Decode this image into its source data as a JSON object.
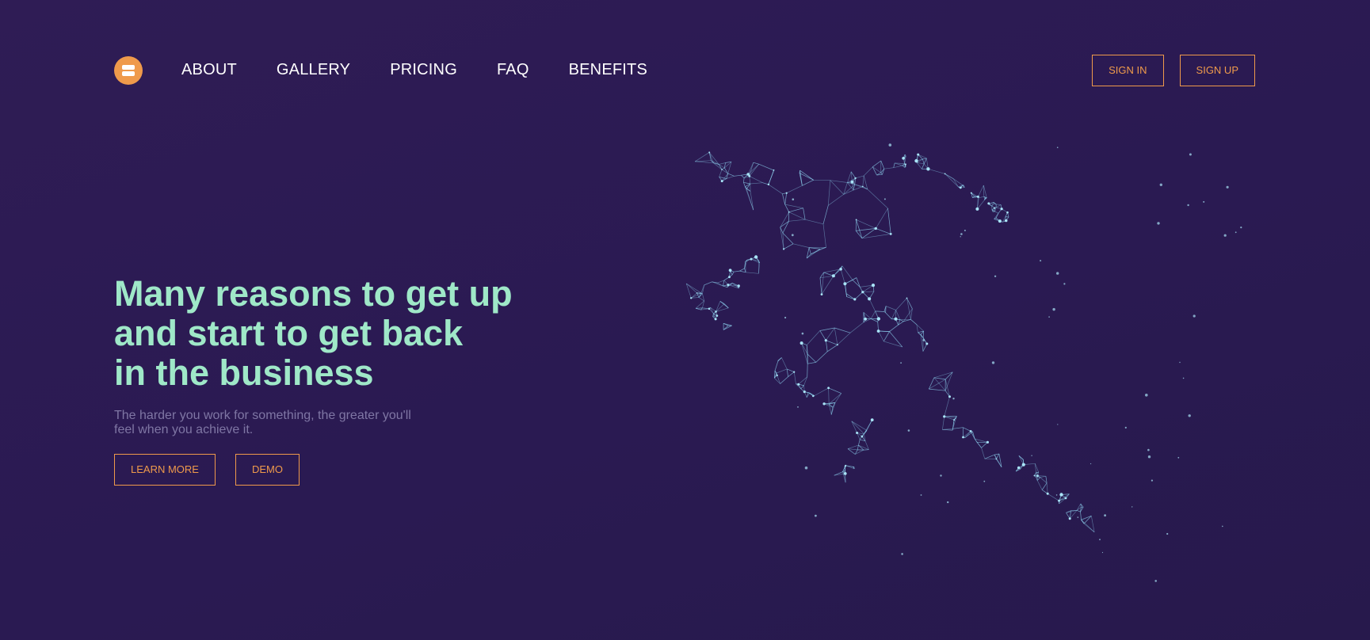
{
  "header": {
    "nav": [
      "ABOUT",
      "GALLERY",
      "PRICING",
      "FAQ",
      "BENEFITS"
    ],
    "sign_in": "SIGN IN",
    "sign_up": "SIGN UP"
  },
  "hero": {
    "title_lines": [
      "Many reasons to get up",
      "and start to get back",
      "in the business"
    ],
    "subtitle_lines": [
      "The harder you work for something, the greater you'll",
      "feel when you achieve it."
    ],
    "learn_more": "LEARN MORE",
    "demo": "DEMO"
  },
  "colors": {
    "background": "#2c1b53",
    "accent": "#ef9a4b",
    "heading": "#9fe8c8",
    "subtext": "#7f76a4",
    "mesh": "#8fd2f0"
  },
  "icons": {
    "logo": "logo-icon",
    "illustration": "wireframe-runner-illustration"
  }
}
